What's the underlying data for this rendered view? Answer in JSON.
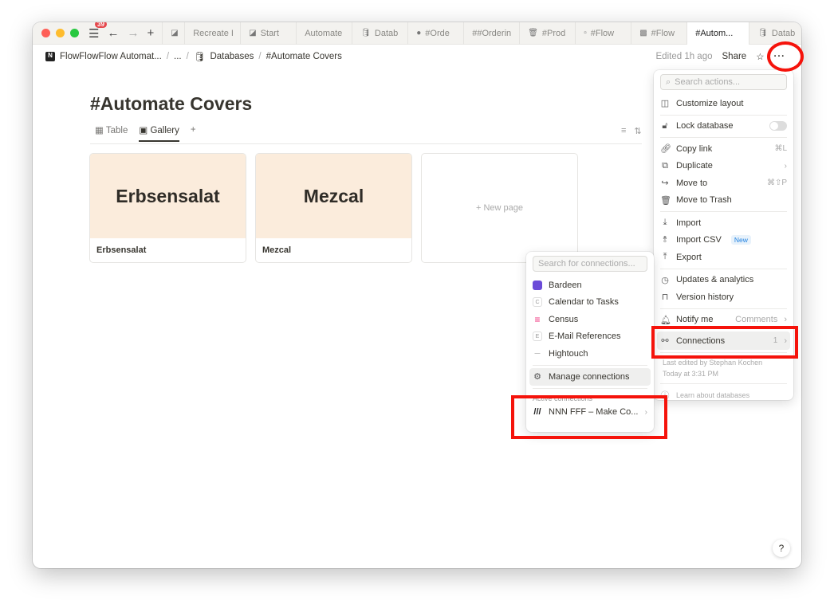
{
  "browser": {
    "badge_count": "39",
    "tabs": [
      {
        "label": "",
        "icon": "notion-icon"
      },
      {
        "label": "Recreate I",
        "icon": ""
      },
      {
        "label": "Start",
        "icon": "notion-icon"
      },
      {
        "label": "Automate",
        "icon": ""
      },
      {
        "label": "Datab",
        "icon": "database-icon"
      },
      {
        "label": "#Orde",
        "icon": "apple-icon"
      },
      {
        "label": "##Orderin",
        "icon": ""
      },
      {
        "label": "#Prod",
        "icon": "trash-icon"
      },
      {
        "label": "#Flow",
        "icon": "page-icon"
      },
      {
        "label": "#Flow",
        "icon": "image-icon"
      },
      {
        "label": "#Autom...",
        "icon": "",
        "active": true
      },
      {
        "label": "Datab",
        "icon": "database-icon"
      }
    ]
  },
  "breadcrumb": {
    "workspace": "FlowFlowFlow Automat...",
    "ellipsis": "...",
    "databases": "Databases",
    "page": "#Automate Covers"
  },
  "topbar": {
    "edited": "Edited 1h ago",
    "share": "Share"
  },
  "page": {
    "title": "#Automate Covers",
    "views": [
      "Table",
      "Gallery"
    ],
    "active_view": "Gallery"
  },
  "cards": [
    {
      "cover": "Erbsensalat",
      "label": "Erbsensalat"
    },
    {
      "cover": "Mezcal",
      "label": "Mezcal"
    }
  ],
  "new_page": "+ New page",
  "menu": {
    "search_placeholder": "Search actions...",
    "customize": "Customize layout",
    "lock": "Lock database",
    "lock_on": false,
    "copy_link": "Copy link",
    "copy_link_sc": "⌘L",
    "duplicate": "Duplicate",
    "move_to": "Move to",
    "move_to_sc": "⌘⇧P",
    "trash": "Move to Trash",
    "import": "Import",
    "import_csv": "Import CSV",
    "new_badge": "New",
    "export": "Export",
    "updates": "Updates & analytics",
    "version": "Version history",
    "notify": "Notify me",
    "notify_value": "Comments",
    "connections": "Connections",
    "connections_count": "1",
    "last_edited": "Last edited by Stephan Kochen",
    "last_edited_time": "Today at 3:31 PM",
    "learn": "Learn about databases"
  },
  "connections": {
    "search_placeholder": "Search for connections...",
    "items": [
      {
        "name": "Bardeen",
        "color": "#6b4bd8"
      },
      {
        "name": "Calendar to Tasks",
        "letter": "C"
      },
      {
        "name": "Census",
        "color": "#f0307c"
      },
      {
        "name": "E-Mail References",
        "letter": "E"
      },
      {
        "name": "Hightouch"
      }
    ],
    "manage": "Manage connections",
    "active_header": "Active connections",
    "active": "NNN FFF – Make Co..."
  },
  "colors": {
    "annotation": "#f5130b",
    "cover": "#fbecdc"
  }
}
